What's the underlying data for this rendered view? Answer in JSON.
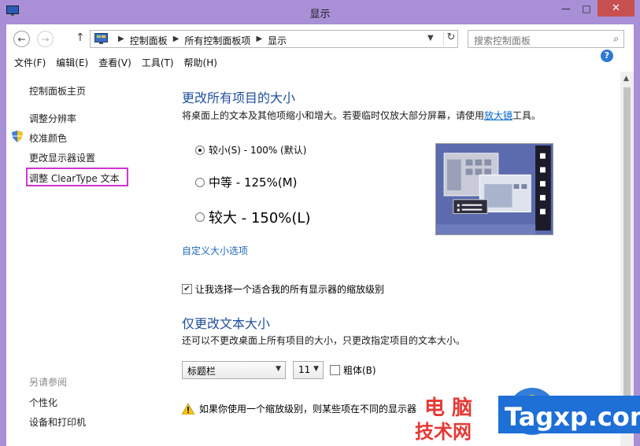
{
  "window": {
    "title": "显示",
    "minimize_glyph": "—",
    "maximize_glyph": "□",
    "close_glyph": "✕"
  },
  "nav": {
    "back_glyph": "←",
    "forward_glyph": "→",
    "up_glyph": "↑",
    "breadcrumbs": [
      "控制面板",
      "所有控制面板项",
      "显示"
    ],
    "search_placeholder": "搜索控制面板"
  },
  "menu": [
    "文件(F)",
    "编辑(E)",
    "查看(V)",
    "工具(T)",
    "帮助(H)"
  ],
  "sidebar": {
    "links": [
      "控制面板主页",
      "调整分辨率",
      "校准颜色",
      "更改显示器设置",
      "调整 ClearType 文本"
    ],
    "see_also_label": "另请参阅",
    "see_also": [
      "个性化",
      "设备和打印机"
    ]
  },
  "main": {
    "heading": "更改所有项目的大小",
    "description_prefix": "将桌面上的文本及其他项缩小和增大。若要临时仅放大部分屏幕，请使用",
    "magnifier_link": "放大镜",
    "description_suffix": "工具。",
    "options": [
      {
        "label": "较小(S) - 100% (默认)",
        "selected": true
      },
      {
        "label": "中等 - 125%(M)",
        "selected": false
      },
      {
        "label": "较大 - 150%(L)",
        "selected": false
      }
    ],
    "custom_link": "自定义大小选项",
    "checkbox_label": "让我选择一个适合我的所有显示器的缩放级别",
    "checkbox_checked": true,
    "heading2": "仅更改文本大小",
    "description2": "还可以不更改桌面上所有项目的大小，只更改指定项目的文本大小。",
    "item_select": "标题栏",
    "size_select": "11",
    "bold_label": "粗体(B)",
    "bold_checked": false,
    "warning_text": "如果你使用一个缩放级别，则某些项在不同的显示器"
  },
  "help_glyph": "?",
  "watermark": {
    "line1": "电 脑",
    "line2": "技术网",
    "site": "Tagxp.com"
  },
  "colors": {
    "frame": "#a88fd6",
    "close": "#c75050",
    "heading": "#1f4e9b",
    "link": "#0066cc",
    "highlight": "#d233d2"
  }
}
